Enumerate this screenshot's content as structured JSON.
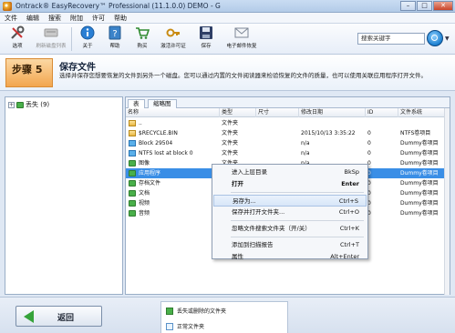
{
  "window": {
    "title": "Ontrack® EasyRecovery™ Professional (11.1.0.0) DEMO - G",
    "minimize": "–",
    "maximize": "□",
    "close": "✕"
  },
  "menu": [
    "文件",
    "编辑",
    "搜索",
    "附加",
    "许可",
    "帮助"
  ],
  "toolbar": {
    "tools": [
      {
        "label": "选项",
        "icon": "tools-icon",
        "disabled": false
      },
      {
        "label": "刷新磁盘列表",
        "icon": "refresh-disk-icon",
        "disabled": true
      },
      {
        "label": "关于",
        "icon": "info-icon",
        "disabled": false
      },
      {
        "label": "帮助",
        "icon": "help-icon",
        "disabled": false
      },
      {
        "label": "购买",
        "icon": "cart-icon",
        "disabled": false
      },
      {
        "label": "激活许可证",
        "icon": "key-icon",
        "disabled": false
      },
      {
        "label": "保存",
        "icon": "save-icon",
        "disabled": false
      },
      {
        "label": "电子邮件恢复",
        "icon": "email-icon",
        "disabled": false
      }
    ],
    "search_value": "搜索关键字"
  },
  "step": {
    "label": "步骤 5",
    "title": "保存文件",
    "description": "选择并保存您想要恢复的文件到另外一个磁盘。您可以通过内置的文件阅读器来检验恢复的文件的质量，也可以使用关联应用程序打开文件。"
  },
  "tree": {
    "root_label": "丢失 (9)",
    "expander": "+"
  },
  "list": {
    "tabs": [
      "表",
      "缩略图"
    ],
    "columns": [
      "名称",
      "类型",
      "尺寸",
      "修改日期",
      "ID",
      "文件系统"
    ],
    "rows": [
      {
        "name": "..",
        "type": "文件夹",
        "size": "",
        "date": "",
        "id": "",
        "fs": "",
        "icon": "folder"
      },
      {
        "name": "$RECYCLE.BIN",
        "type": "文件夹",
        "size": "",
        "date": "2015/10/13 3:35:22",
        "id": "0",
        "fs": "NTFS卷项目",
        "icon": "folder"
      },
      {
        "name": "Block 29504",
        "type": "文件夹",
        "size": "",
        "date": "n/a",
        "id": "0",
        "fs": "Dummy卷项目",
        "icon": "blue"
      },
      {
        "name": "NTFS lost at block 0",
        "type": "文件夹",
        "size": "",
        "date": "n/a",
        "id": "0",
        "fs": "Dummy卷项目",
        "icon": "blue"
      },
      {
        "name": "图像",
        "type": "文件夹",
        "size": "",
        "date": "n/a",
        "id": "0",
        "fs": "Dummy卷项目",
        "icon": "green"
      },
      {
        "name": "应用程序",
        "type": "文件夹",
        "size": "",
        "date": "n/a",
        "id": "0",
        "fs": "Dummy卷项目",
        "icon": "green",
        "selected": true
      },
      {
        "name": "存档文件",
        "type": "文件夹",
        "size": "",
        "date": "n/a",
        "id": "0",
        "fs": "Dummy卷项目",
        "icon": "green"
      },
      {
        "name": "文档",
        "type": "文件夹",
        "size": "",
        "date": "n/a",
        "id": "0",
        "fs": "Dummy卷项目",
        "icon": "green"
      },
      {
        "name": "视频",
        "type": "文件夹",
        "size": "",
        "date": "n/a",
        "id": "0",
        "fs": "Dummy卷项目",
        "icon": "green"
      },
      {
        "name": "音频",
        "type": "文件夹",
        "size": "",
        "date": "n/a",
        "id": "0",
        "fs": "Dummy卷项目",
        "icon": "green"
      }
    ]
  },
  "context_menu": [
    {
      "label": "进入上层目录",
      "shortcut": "BkSp",
      "bold": false
    },
    {
      "label": "打开",
      "shortcut": "Enter",
      "bold": true
    },
    {
      "sep": true
    },
    {
      "label": "另存为...",
      "shortcut": "Ctrl+S",
      "bold": false,
      "hover": true
    },
    {
      "label": "保存并打开文件夹...",
      "shortcut": "Ctrl+O",
      "bold": false
    },
    {
      "sep": true
    },
    {
      "label": "忽略文件搜索文件夹（开/关）",
      "shortcut": "Ctrl+K",
      "bold": false
    },
    {
      "sep": true
    },
    {
      "label": "添加到扫描报告",
      "shortcut": "Ctrl+T",
      "bold": false
    },
    {
      "label": "属性",
      "shortcut": "Alt+Enter",
      "bold": false
    }
  ],
  "bottom": {
    "back_label": "返回",
    "legend": [
      {
        "label": "丢失或删除的文件夹",
        "kind": "green"
      },
      {
        "label": "正常文件夹",
        "kind": "blue"
      }
    ]
  }
}
